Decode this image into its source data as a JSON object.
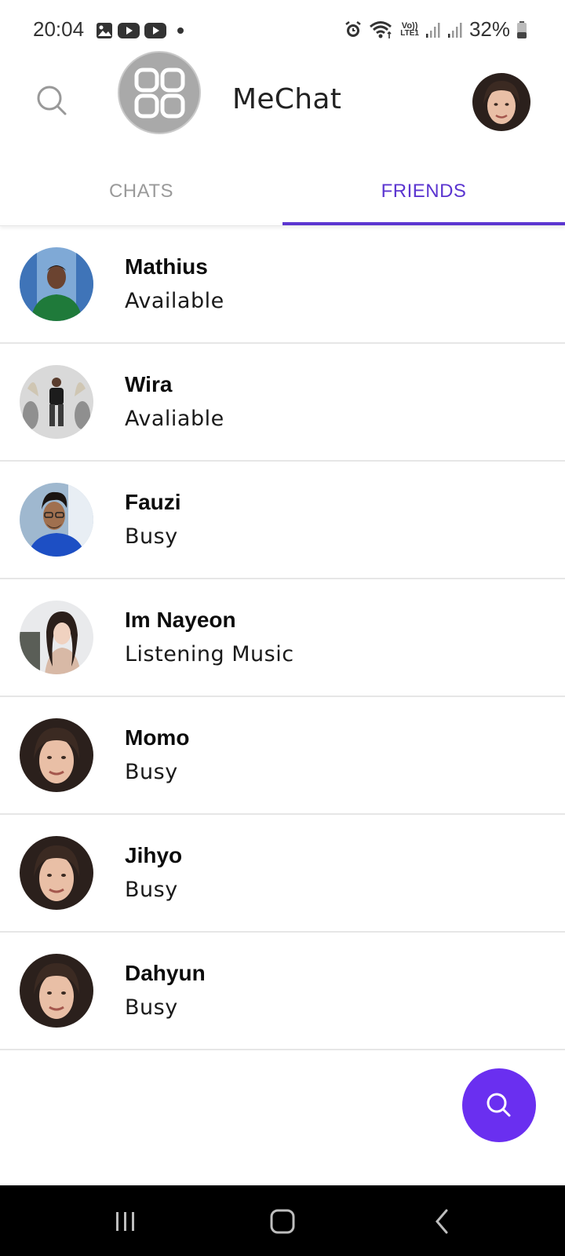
{
  "status_bar": {
    "time": "20:04",
    "battery": "32%",
    "left_icons": [
      "gallery-icon",
      "youtube-icon",
      "youtube-icon",
      "dot-icon"
    ],
    "right_icons": [
      "alarm-icon",
      "wifi-icon",
      "volte-icon",
      "signal-icon",
      "signal-icon",
      "battery-icon"
    ],
    "volte_label": "Vo))",
    "lte_label": "LTE1"
  },
  "header": {
    "title": "MeChat",
    "search_icon": "search-icon",
    "logo_icon": "app-grid-icon",
    "profile_avatar": "user-avatar"
  },
  "tabs": [
    {
      "label": "CHATS",
      "active": false
    },
    {
      "label": "FRIENDS",
      "active": true
    }
  ],
  "friends": [
    {
      "name": "Mathius",
      "status": "Available"
    },
    {
      "name": "Wira",
      "status": "Avaliable"
    },
    {
      "name": "Fauzi",
      "status": "Busy"
    },
    {
      "name": "Im Nayeon",
      "status": "Listening Music"
    },
    {
      "name": "Momo",
      "status": "Busy"
    },
    {
      "name": "Jihyo",
      "status": "Busy"
    },
    {
      "name": "Dahyun",
      "status": "Busy"
    }
  ],
  "fab": {
    "icon": "search-icon"
  },
  "nav_bar": {
    "buttons": [
      "recents-icon",
      "home-icon",
      "back-icon"
    ]
  },
  "colors": {
    "accent": "#5b35d0",
    "fab": "#6a2ff0",
    "divider": "#e6e6e6",
    "inactive_tab": "#9a9a9a",
    "nav_bar": "#000000"
  }
}
